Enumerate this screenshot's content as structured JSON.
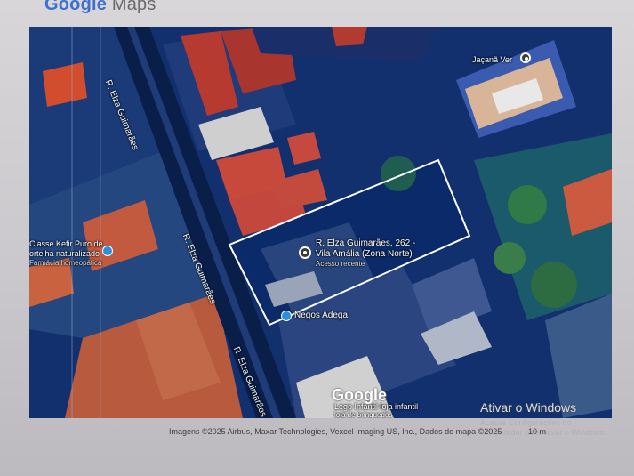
{
  "header": {
    "brand_google": "Google",
    "brand_maps": "Maps"
  },
  "map": {
    "selected_place": {
      "address_line1": "R. Elza Guimarães, 262 -",
      "address_line2": "Vila Amália (Zona Norte)",
      "status": "Acesso recente"
    },
    "places": {
      "top_right": "Jaçanã Ver",
      "left_poi_line1": "Classe Kefir Puro de",
      "left_poi_line2": "ortelha naturalizado",
      "left_poi_line3": "Farmácia homeopática",
      "adega": "Negos Adega",
      "bottom_label_line1": "Lego Infantil loja infantil",
      "bottom_label_line2": "loja de brinquedos"
    },
    "streets": [
      "R. Elza Guimarães",
      "R. Elza Guimarães",
      "R. Elza Guimarães"
    ]
  },
  "watermark": "Google",
  "footer": {
    "attribution": "Imagens ©2025 Airbus, Maxar Technologies, Vexcel Imaging US, Inc., Dados do mapa ©2025",
    "scale": "10 m"
  },
  "overlay": {
    "activate_title": "Ativar o Windows",
    "activate_sub": "Acesse Configurações do computador para ativar o Windows."
  }
}
